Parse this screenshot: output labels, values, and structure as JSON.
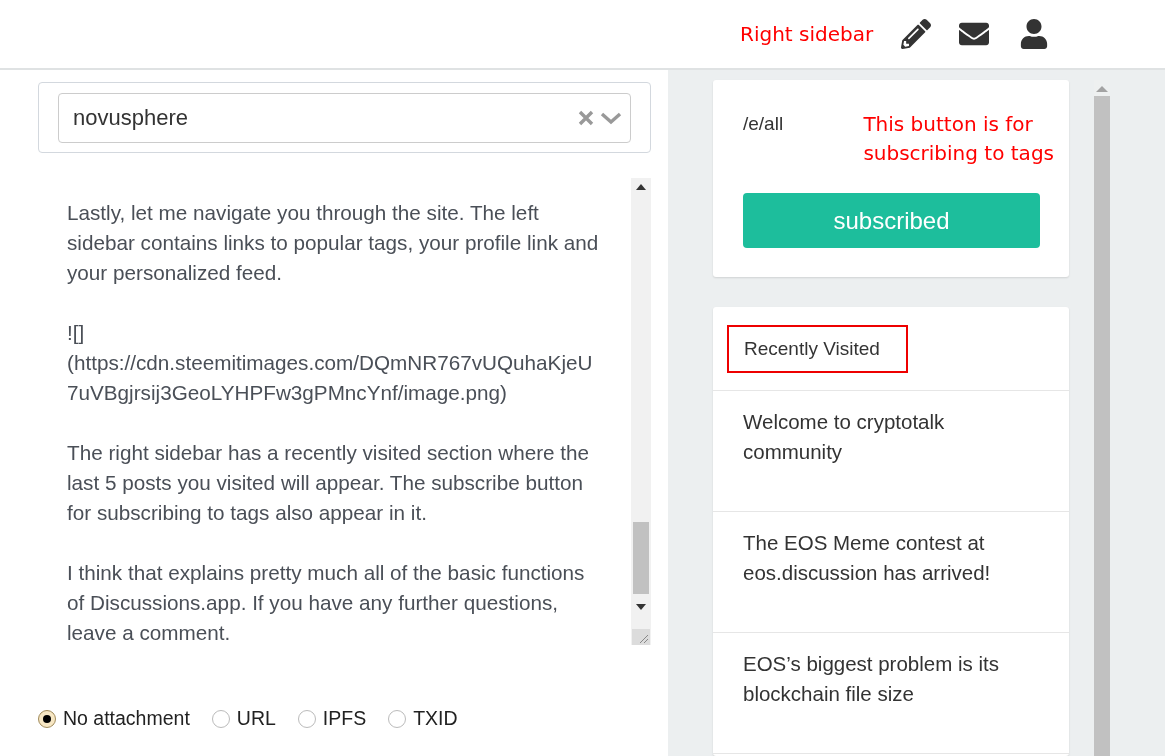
{
  "header": {
    "annotation": "Right sidebar"
  },
  "tag_select": {
    "value": "novusphere"
  },
  "editor": {
    "value": "Lastly, let me navigate you through the site. The left sidebar contains links to popular tags, your profile link and your personalized feed.\n\n![](https://cdn.steemitimages.com/DQmNR767vUQuhaKjeU7uVBgjrsij3GeoLYHPFw3gPMncYnf/image.png)\n\nThe right sidebar has a recently visited section where the last 5 posts you visited will appear. The subscribe button for subscribing to tags also appear in it.\n\nI think that explains pretty much all of the basic functions of Discussions.app. If you have any further questions, leave a comment."
  },
  "attachment_options": [
    {
      "label": "No attachment",
      "selected": true
    },
    {
      "label": "URL",
      "selected": false
    },
    {
      "label": "IPFS",
      "selected": false
    },
    {
      "label": "TXID",
      "selected": false
    }
  ],
  "tag_card": {
    "tag": "/e/all",
    "annotation_lines": [
      "This button is for",
      "subscribing to tags"
    ],
    "button": "subscribed"
  },
  "recently_visited": {
    "title": "Recently Visited",
    "highlighted": true,
    "items": [
      "Welcome to cryptotalk community",
      "The EOS Meme contest at eos.discussion has arrived!",
      "EOS’s biggest problem is its blockchain file size"
    ]
  }
}
